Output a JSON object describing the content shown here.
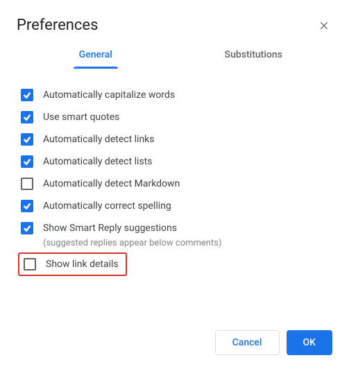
{
  "title": "Preferences",
  "tabs": {
    "general": "General",
    "substitutions": "Substitutions"
  },
  "options": {
    "capitalize": "Automatically capitalize words",
    "smartquotes": "Use smart quotes",
    "detectlinks": "Automatically detect links",
    "detectlists": "Automatically detect lists",
    "detectmarkdown": "Automatically detect Markdown",
    "correctspelling": "Automatically correct spelling",
    "smartreply": "Show Smart Reply suggestions",
    "smartreply_hint": "(suggested replies appear below comments)",
    "linkdetails": "Show link details"
  },
  "buttons": {
    "cancel": "Cancel",
    "ok": "OK"
  }
}
